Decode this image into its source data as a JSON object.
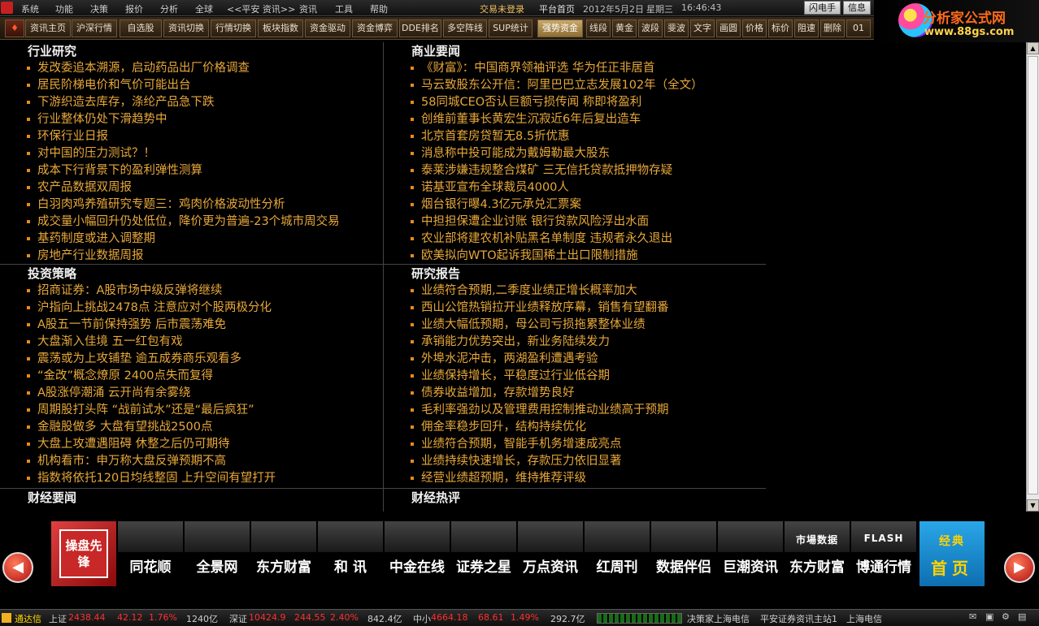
{
  "menubar": {
    "items": [
      "系统",
      "功能",
      "决策",
      "报价",
      "分析",
      "全球",
      "<<平安 资讯>>",
      "资讯",
      "工具",
      "帮助"
    ],
    "status": "交易未登录",
    "page": "平台首页",
    "date": "2012年5月2日",
    "weekday": "星期三",
    "time": "16:46:43",
    "flash_btn": "闪电手",
    "info_btn": "信息"
  },
  "toolbar": {
    "items": [
      "资讯主页",
      "沪深行情",
      "自选股",
      "资讯切换",
      "行情切换",
      "板块指数",
      "资金驱动",
      "资金博弈",
      "DDE排名",
      "多空阵线",
      "SUP统计",
      "强势资金",
      "线段",
      "黄金",
      "波段",
      "斐波",
      "文字",
      "画圆",
      "价格",
      "标价",
      "阻速",
      "删除",
      "01"
    ],
    "active": "强势资金"
  },
  "brand": {
    "title": "分析家公式网",
    "url": "www.88gs.com"
  },
  "panels": {
    "industry": {
      "title": "行业研究",
      "items": [
        "发改委追本溯源，启动药品出厂价格调查",
        "居民阶梯电价和气价可能出台",
        "下游织造去库存，涤纶产品急下跌",
        "行业整体仍处下滑趋势中",
        "环保行业日报",
        "对中国的压力测试？！",
        "成本下行背景下的盈利弹性测算",
        "农产品数据双周报",
        "白羽肉鸡养殖研究专题三：鸡肉价格波动性分析",
        "成交量小幅回升仍处低位，降价更为普遍-23个城市周交易",
        "基药制度或进入调整期",
        "房地产行业数据周报"
      ]
    },
    "business": {
      "title": "商业要闻",
      "items": [
        "《财富》：中国商界领袖评选 华为任正非居首",
        "马云致股东公开信：阿里巴巴立志发展102年（全文）",
        "58同城CEO否认巨额亏损传闻 称即将盈利",
        "创维前董事长黄宏生沉寂近6年后复出造车",
        "北京首套房贷暂无8.5折优惠",
        "消息称中投可能成为戴姆勒最大股东",
        "泰莱涉嫌违规整合煤矿 三无信托贷款抵押物存疑",
        "诺基亚宣布全球裁员4000人",
        "烟台银行曝4.3亿元承兑汇票案",
        "中担担保遭企业讨账 银行贷款风险浮出水面",
        "农业部将建农机补贴黑名单制度 违规者永久退出",
        "欧美拟向WTO起诉我国稀土出口限制措施"
      ]
    },
    "strategy": {
      "title": "投资策略",
      "items": [
        "招商证券：A股市场中级反弹将继续",
        "沪指向上挑战2478点 注意应对个股两极分化",
        "A股五一节前保持强势 后市震荡难免",
        "大盘渐入佳境 五一红包有戏",
        "震荡或为上攻铺垫 逾五成券商乐观看多",
        "“金改”概念燎原 2400点失而复得",
        "A股涨停潮涌 云开尚有余雾绕",
        "周期股打头阵 “战前试水”还是“最后疯狂”",
        "金融股做多 大盘有望挑战2500点",
        "大盘上攻遭遇阻碍 休整之后仍可期待",
        "机构看市：申万称大盘反弹预期不高",
        "指数将依托120日均线整固 上升空间有望打开"
      ]
    },
    "research": {
      "title": "研究报告",
      "items": [
        "业绩符合预期,二季度业绩正增长概率加大",
        "西山公馆热销拉开业绩释放序幕，销售有望翻番",
        "业绩大幅低预期，母公司亏损拖累整体业绩",
        "承销能力优势突出，新业务陆续发力",
        "外埠水泥冲击，两湖盈利遭遇考验",
        "业绩保持增长，平稳度过行业低谷期",
        "债券收益增加，存款增势良好",
        "毛利率强劲以及管理费用控制推动业绩高于预期",
        "佣金率稳步回升，结构持续优化",
        "业绩符合预期，智能手机务增速成亮点",
        "业绩持续快速增长，存款压力依旧显著",
        "经营业绩超预期，维持推荐评级"
      ]
    },
    "finance": {
      "title": "财经要闻",
      "items": []
    },
    "comment": {
      "title": "财经热评",
      "items": []
    }
  },
  "linkbar": {
    "red_tile": "操盘先锋",
    "tiles": [
      {
        "label": "同花顺",
        "sub": ""
      },
      {
        "label": "全景网",
        "sub": ""
      },
      {
        "label": "东方财富",
        "sub": ""
      },
      {
        "label": "和 讯",
        "sub": ""
      },
      {
        "label": "中金在线",
        "sub": ""
      },
      {
        "label": "证券之星",
        "sub": ""
      },
      {
        "label": "万点资讯",
        "sub": ""
      },
      {
        "label": "红周刊",
        "sub": ""
      },
      {
        "label": "数据伴侣",
        "sub": ""
      },
      {
        "label": "巨潮资讯",
        "sub": ""
      },
      {
        "label": "东方财富",
        "sub": "市場数据"
      },
      {
        "label": "博通行情",
        "sub": "FLASH"
      }
    ],
    "home_top": "经典",
    "home_bottom": "首页",
    "prev_icon": "◀",
    "next_icon": "▶"
  },
  "statusbar": {
    "app": "通达信",
    "sh_label": "上证",
    "sh_value": "2438.44",
    "sh_change": "42.12",
    "sh_pct": "1.76%",
    "sh_amount": "1240亿",
    "sz_label": "深证",
    "sz_value": "10424.9",
    "sz_change": "244.55",
    "sz_pct": "2.40%",
    "sz_amount": "842.4亿",
    "zx_label": "中小",
    "zx_value": "4664.18",
    "zx_change": "68.61",
    "zx_pct": "1.49%",
    "zx_amount": "292.7亿",
    "server1": "决策家上海电信",
    "server2": "平安证券资讯主站1",
    "server3": "上海电信"
  }
}
